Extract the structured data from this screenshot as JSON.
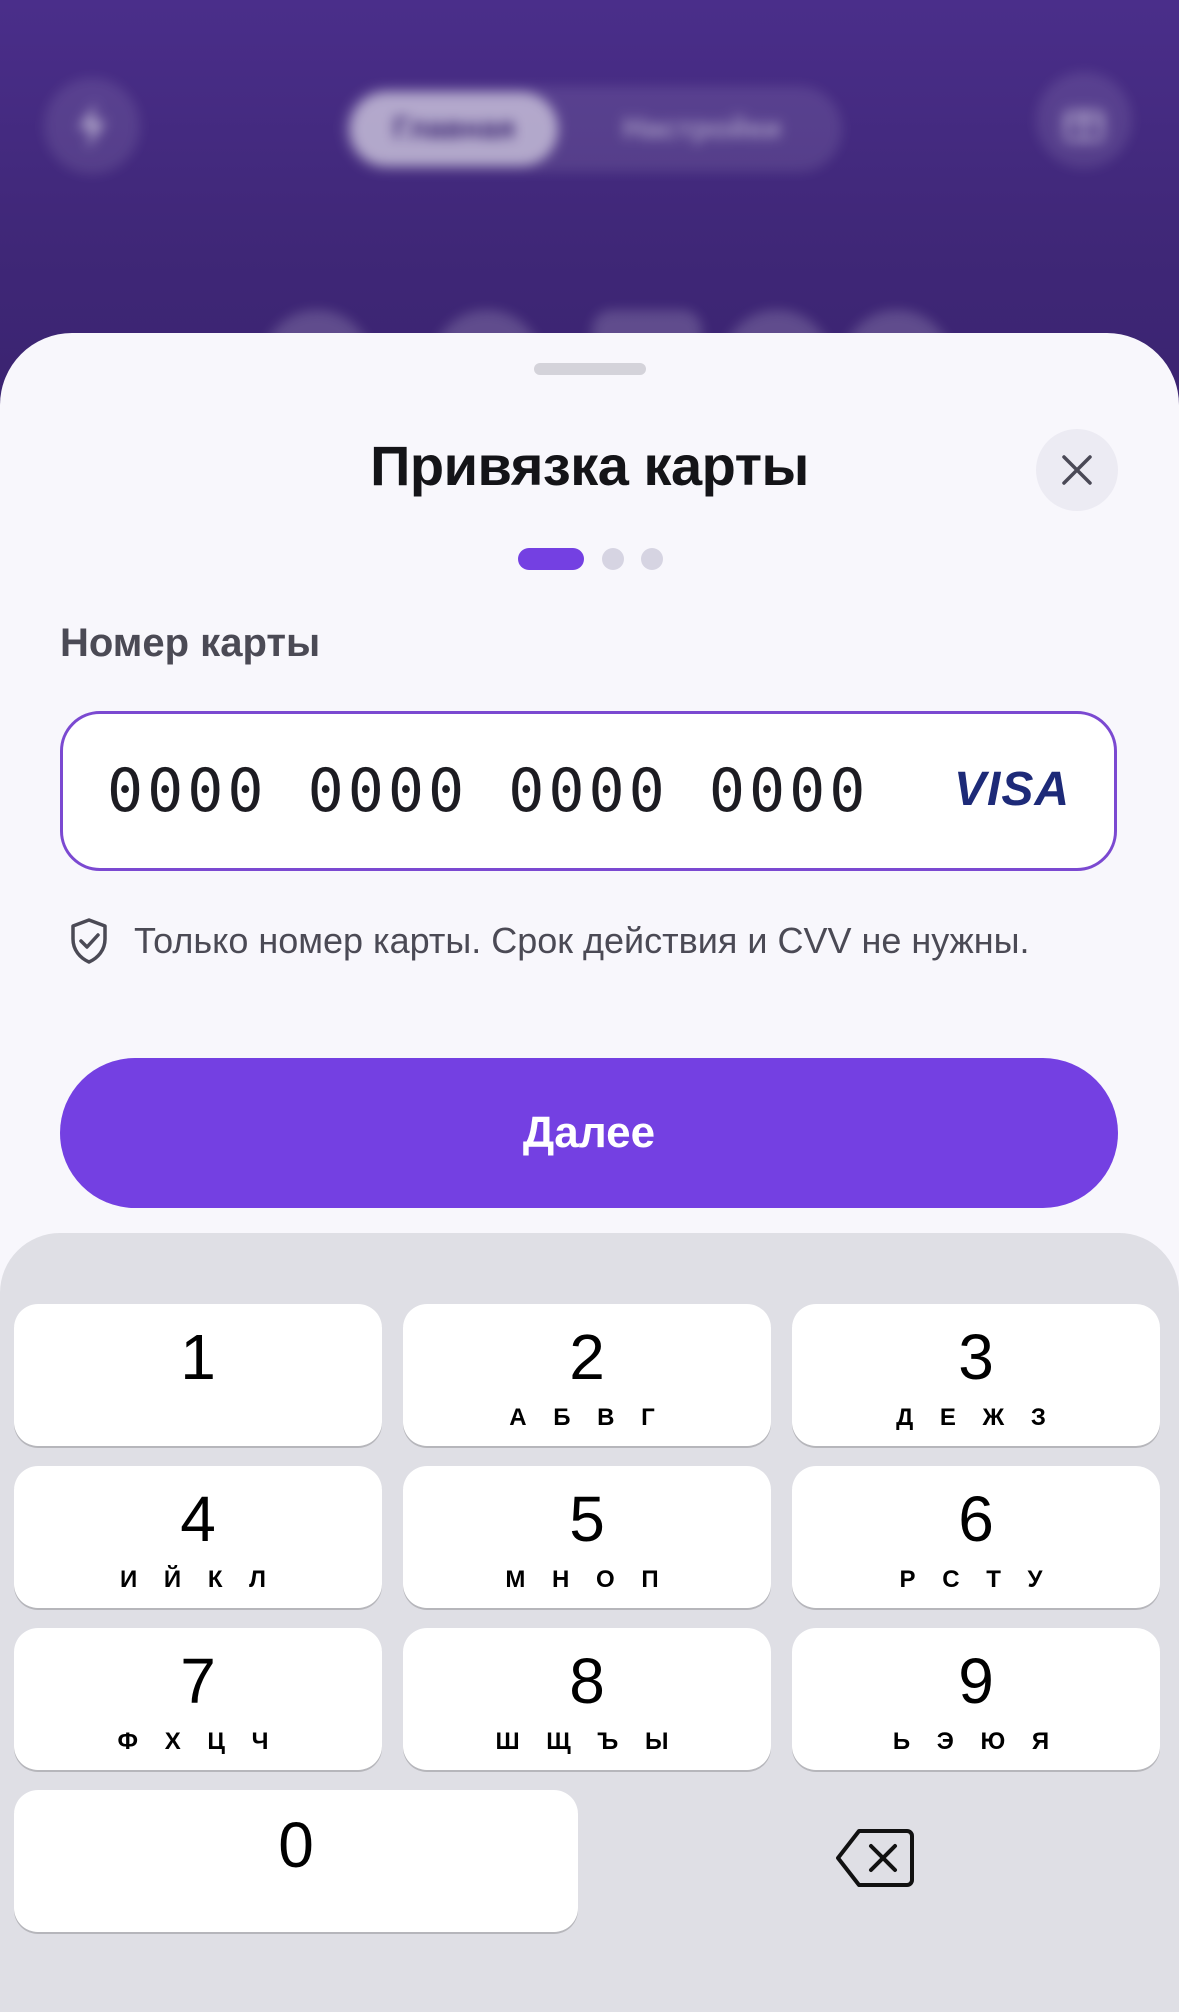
{
  "background": {
    "tabs": [
      {
        "label": "Главная",
        "active": true
      },
      {
        "label": "Настройки",
        "active": false
      }
    ]
  },
  "sheet": {
    "title": "Привязка карты",
    "steps": {
      "total": 3,
      "current": 1
    },
    "card_number_label": "Номер карты",
    "card_number_placeholder": "0000 0000 0000 0000",
    "card_brand": "VISA",
    "hint": "Только номер карты. Срок действия и CVV не нужны.",
    "next_button": "Далее"
  },
  "keyboard": {
    "keys": [
      {
        "digit": "1",
        "letters": ""
      },
      {
        "digit": "2",
        "letters": "А Б В Г"
      },
      {
        "digit": "3",
        "letters": "Д Е Ж З"
      },
      {
        "digit": "4",
        "letters": "И Й К Л"
      },
      {
        "digit": "5",
        "letters": "М Н О П"
      },
      {
        "digit": "6",
        "letters": "Р С Т У"
      },
      {
        "digit": "7",
        "letters": "Ф Х Ц Ч"
      },
      {
        "digit": "8",
        "letters": "Ш Щ Ъ Ы"
      },
      {
        "digit": "9",
        "letters": "Ь Э Ю Я"
      },
      {
        "digit": "0",
        "letters": ""
      }
    ]
  },
  "colors": {
    "accent": "#7440e2",
    "background_purple": "#3d2676",
    "visa_blue": "#1d2a78"
  },
  "icons": [
    "lightning-icon",
    "gift-icon",
    "close-icon",
    "shield-check-icon",
    "backspace-icon"
  ]
}
